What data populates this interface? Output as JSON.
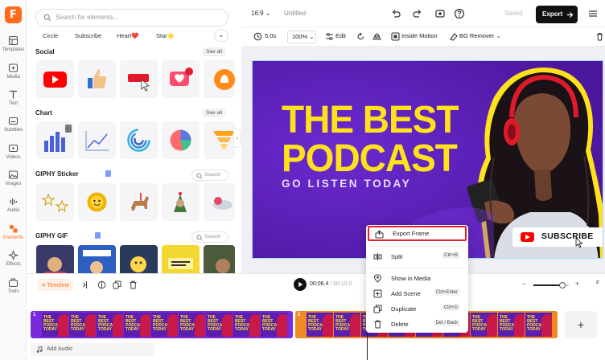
{
  "brand": {
    "logo_letter": "F",
    "accent": "#ff6b1a"
  },
  "sidebar": {
    "items": [
      {
        "label": "Templates",
        "icon": "templates-icon"
      },
      {
        "label": "Media",
        "icon": "media-icon"
      },
      {
        "label": "Text",
        "icon": "text-icon"
      },
      {
        "label": "Subtitles",
        "icon": "subtitles-icon"
      },
      {
        "label": "Videos",
        "icon": "videos-icon"
      },
      {
        "label": "Images",
        "icon": "images-icon"
      },
      {
        "label": "Audio",
        "icon": "audio-icon"
      },
      {
        "label": "Elements",
        "icon": "elements-icon",
        "active": true
      },
      {
        "label": "Effects",
        "icon": "effects-icon"
      },
      {
        "label": "Tools",
        "icon": "tools-icon"
      }
    ]
  },
  "elements_panel": {
    "search_placeholder": "Search for elements...",
    "chips": [
      "Circle",
      "Subscribe",
      "Heart❤️",
      "Star🌟"
    ],
    "sections": [
      {
        "title": "Social",
        "action": "See all"
      },
      {
        "title": "Chart",
        "action": "See all"
      },
      {
        "title": "GIPHY Sticker",
        "search": "Search"
      },
      {
        "title": "GIPHY GIF",
        "search": "Search"
      }
    ]
  },
  "header": {
    "ratio": "16:9",
    "title": "Untitled",
    "saved": "Saved",
    "export_label": "Export"
  },
  "toolbar": {
    "duration": "5.0s",
    "zoom": "100%",
    "edit": "Edit",
    "inside_motion": "Inside Motion",
    "bg_remover": "BG Remover"
  },
  "canvas": {
    "headline_line1": "THE BEST",
    "headline_line2": "PODCAST",
    "subline": "GO LISTEN TODAY",
    "subscribe": "SUBSCRIBE",
    "bg_color": "#5a1fb0",
    "headline_color": "#ffe21a"
  },
  "context_menu": {
    "items": [
      {
        "label": "Export Frame",
        "icon": "export-frame-icon",
        "shortcut": "",
        "highlighted": true
      },
      {
        "label": "Split",
        "icon": "split-icon",
        "shortcut": "Ctrl+B"
      },
      {
        "label": "Show in Media",
        "icon": "location-pin-icon",
        "shortcut": ""
      },
      {
        "label": "Add Scene",
        "icon": "add-scene-icon",
        "shortcut": "Ctrl+Enter"
      },
      {
        "label": "Duplicate",
        "icon": "duplicate-icon",
        "shortcut": "Ctrl+D"
      },
      {
        "label": "Delete",
        "icon": "trash-icon",
        "shortcut": "Del / Back"
      }
    ]
  },
  "timeline": {
    "label": "Timeline",
    "current_time": "00:06.4",
    "total_time": "/ 00:10.0",
    "clip1_number": "1",
    "clip2_number": "2",
    "thumb_text": "THE BEST PODCAST TODAY",
    "add_audio": "Add Audio"
  }
}
